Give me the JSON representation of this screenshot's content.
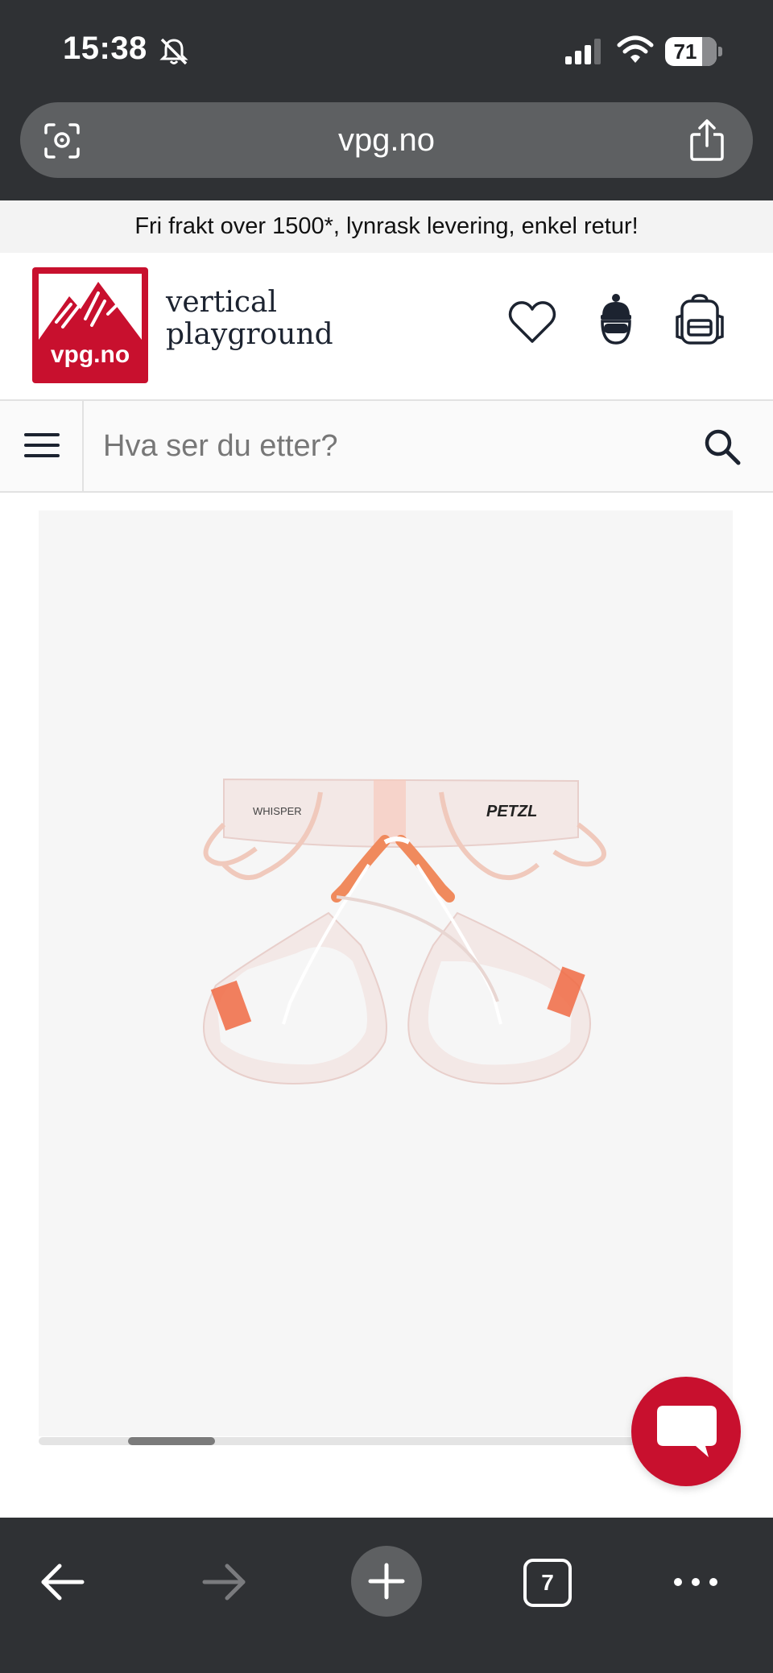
{
  "status_bar": {
    "time": "15:38",
    "battery": "71"
  },
  "browser": {
    "url": "vpg.no",
    "tab_count": "7"
  },
  "promo_banner": "Fri frakt over 1500*, lynrask levering, enkel retur!",
  "header": {
    "logo_text": "vpg.no",
    "brand_line1": "vertical",
    "brand_line2": "playground"
  },
  "search": {
    "placeholder": "Hva ser du etter?"
  },
  "product_image": {
    "label_left": "WHISPER",
    "label_right": "PETZL"
  },
  "gallery": {
    "scroll_progress": 0.16
  },
  "colors": {
    "brand_red": "#c8102e",
    "chrome_dark": "#2f3134",
    "url_bar": "#5e6062"
  },
  "icons": [
    "bell-slash-icon",
    "signal-icon",
    "wifi-icon",
    "lens-icon",
    "share-icon",
    "heart-icon",
    "account-icon",
    "backpack-icon",
    "menu-icon",
    "search-icon",
    "chat-icon",
    "back-icon",
    "forward-icon",
    "plus-icon",
    "more-icon"
  ]
}
